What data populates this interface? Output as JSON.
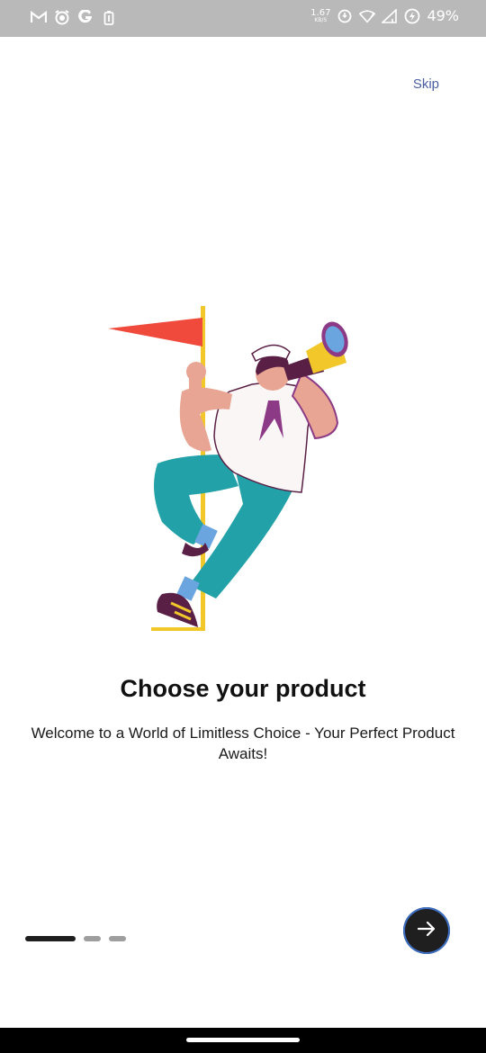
{
  "status_bar": {
    "left_icons": [
      "gmail-icon",
      "alarm-icon",
      "google-icon",
      "battery-saver-icon"
    ],
    "net_speed": "1.67",
    "net_speed_unit": "KB/S",
    "battery_percent": "49%",
    "right_icons": [
      "data-saver-icon",
      "wifi-icon",
      "signal-icon",
      "battery-icon"
    ]
  },
  "onboarding": {
    "skip_label": "Skip",
    "illustration": "sailor-with-flag-and-telescope",
    "title": "Choose your product",
    "subtitle": "Welcome to a World of Limitless Choice - Your Perfect Product Awaits!",
    "page_indicator": {
      "total": 3,
      "current": 1
    },
    "next_icon": "arrow-right-icon"
  },
  "colors": {
    "accent_link": "#4b5ea1",
    "button_bg": "#1f1f1f",
    "button_ring": "#3c6fc4",
    "flag": "#f04a3c",
    "pants": "#22a1a8",
    "telescope": "#f2c72a"
  }
}
